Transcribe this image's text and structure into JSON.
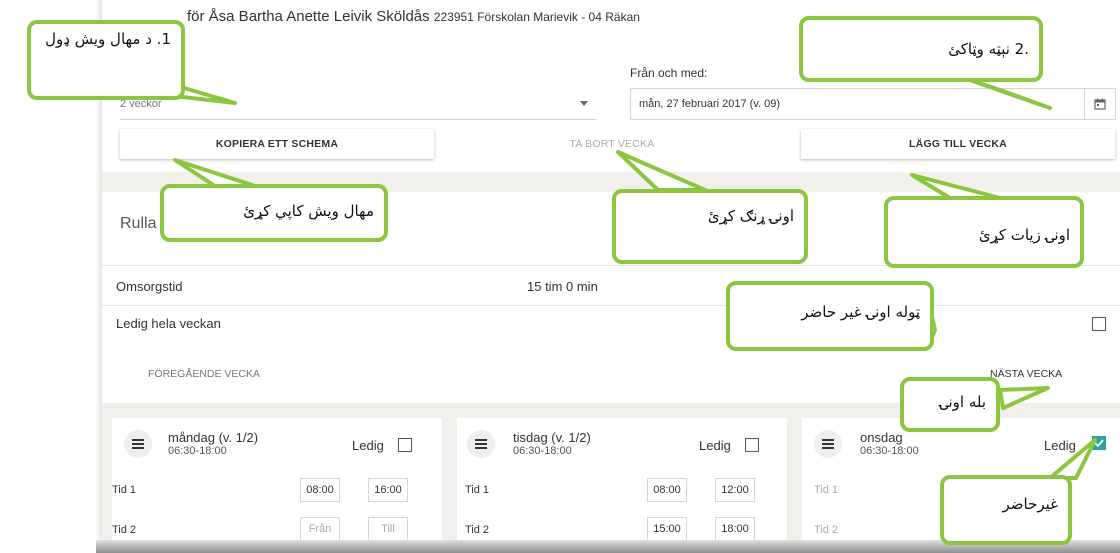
{
  "header": {
    "title_main": "för Åsa Bartha Anette Leivik Sköldås",
    "title_sub": "223951 Förskolan Marievik - 04 Räkan"
  },
  "schedule_select": {
    "value": "2 veckor"
  },
  "date_field": {
    "label": "Från och med:",
    "value": "mån, 27 februari 2017 (v. 09)"
  },
  "buttons": {
    "copy": "KOPIERA ETT SCHEMA",
    "remove_week": "TA BORT VECKA",
    "add_week": "LÄGG TILL VECKA"
  },
  "section": {
    "title_fragment": "Rulla"
  },
  "summary": {
    "care_label": "Omsorgstid",
    "care_value": "15 tim 0 min",
    "free_week_label": "Ledig hela veckan"
  },
  "nav": {
    "prev": "FÖREGÅENDE VECKA",
    "next": "NÄSTA VECKA"
  },
  "days": [
    {
      "name": "måndag (v. 1/2)",
      "hours": "06:30-18:00",
      "ledig": "Ledig",
      "rows": [
        {
          "label": "Tid 1",
          "from": "08:00",
          "to": "16:00"
        },
        {
          "label": "Tid 2",
          "from": "Från",
          "to": "Till"
        }
      ]
    },
    {
      "name": "tisdag (v. 1/2)",
      "hours": "06:30-18:00",
      "ledig": "Ledig",
      "rows": [
        {
          "label": "Tid 1",
          "from": "08:00",
          "to": "12:00"
        },
        {
          "label": "Tid 2",
          "from": "15:00",
          "to": "18:00"
        }
      ]
    },
    {
      "name": "onsdag",
      "hours": "06:30-18:00",
      "ledig": "Ledig",
      "rows": [
        {
          "label": "Tid 1"
        },
        {
          "label": "Tid 2"
        }
      ]
    }
  ],
  "callouts": {
    "c1": "1. د مهال ویش ډول",
    "c2": ".2 نېټه وټاکئ",
    "c3": "مهال ویش کاپي کړئ",
    "c4": "اونۍ ړنګ کړئ",
    "c5": "اونۍ زیات کړئ",
    "c6": "ټوله اونۍ غیر حاضر",
    "c7": "بله اونۍ",
    "c8": "غیرحاضر"
  },
  "colors": {
    "callout_border": "#8cc63f",
    "checkbox_checked": "#2aa3a3",
    "band": "#f1f0ec"
  },
  "icons": {
    "calendar": "calendar-icon",
    "day": "list-icon",
    "check": "check-icon"
  }
}
